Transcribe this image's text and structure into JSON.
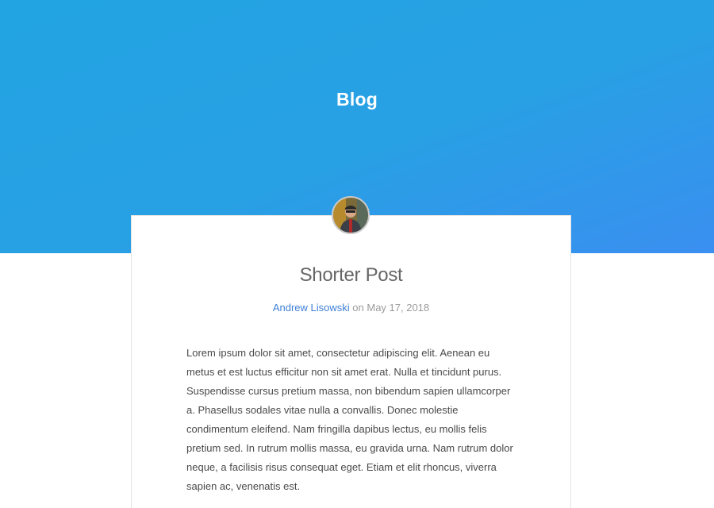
{
  "header": {
    "title": "Blog"
  },
  "post": {
    "title": "Shorter Post",
    "author": "Andrew Lisowski",
    "date_prefix": " on ",
    "date": "May 17, 2018",
    "body": "Lorem ipsum dolor sit amet, consectetur adipiscing elit. Aenean eu metus et est luctus efficitur non sit amet erat. Nulla et tincidunt purus. Suspendisse cursus pretium massa, non bibendum sapien ullamcorper a. Phasellus sodales vitae nulla a convallis. Donec molestie condimentum eleifend. Nam fringilla dapibus lectus, eu mollis felis pretium sed. In rutrum mollis massa, eu gravida urna. Nam rutrum dolor neque, a facilisis risus consequat eget. Etiam et elit rhoncus, viverra sapien ac, venenatis est."
  },
  "colors": {
    "hero_start": "#22a4e2",
    "hero_end": "#3a8ff0",
    "link": "#3d7fd6"
  }
}
